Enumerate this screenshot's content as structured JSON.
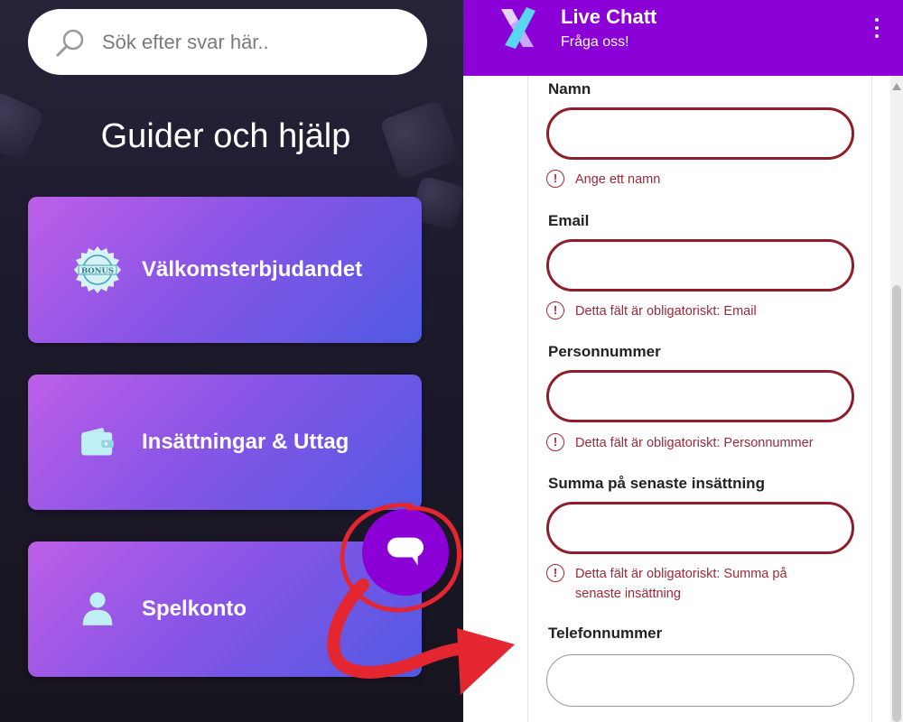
{
  "help": {
    "search_placeholder": "Sök efter svar här..",
    "title": "Guider och hjälp",
    "badge_text": "BONUS",
    "cards": [
      {
        "label": "Välkomsterbjudandet",
        "icon": "bonus-badge-icon"
      },
      {
        "label": "Insättningar & Uttag",
        "icon": "wallet-icon"
      },
      {
        "label": "Spelkonto",
        "icon": "user-icon"
      }
    ]
  },
  "chat": {
    "title": "Live Chatt",
    "subtitle": "Fråga oss!",
    "header_color": "#8a00d6",
    "fields": [
      {
        "label": "Namn",
        "value": "",
        "error": "Ange ett namn"
      },
      {
        "label": "Email",
        "value": "",
        "error": "Detta fält är obligatoriskt: Email"
      },
      {
        "label": "Personnummer",
        "value": "",
        "error": "Detta fält är obligatoriskt: Personnummer"
      },
      {
        "label": "Summa på senaste insättning",
        "value": "",
        "error": "Detta fält är obligatoriskt: Summa på senaste insättning"
      },
      {
        "label": "Telefonnummer",
        "value": "",
        "error": ""
      }
    ],
    "error_color": "#9b2a37"
  },
  "annotation": {
    "color": "#e3262f"
  }
}
